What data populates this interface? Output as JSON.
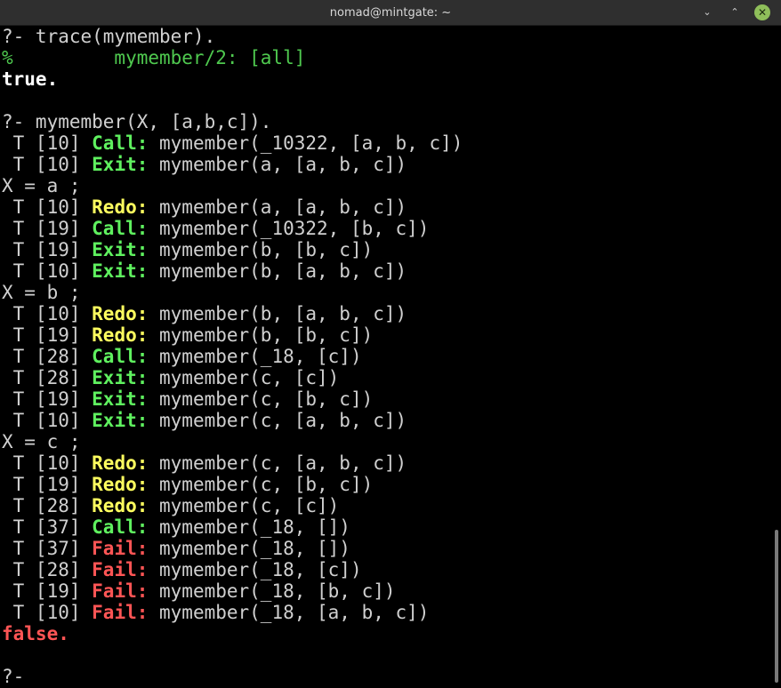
{
  "window": {
    "title": "nomad@mintgate: ~",
    "minimize_label": "⌄",
    "maximize_label": "⌃",
    "close_label": "✕"
  },
  "terminal": {
    "lines": [
      [
        {
          "text": "?- trace(mymember).",
          "style": "plain"
        }
      ],
      [
        {
          "text": "%         mymember/2: [all]",
          "style": "green"
        }
      ],
      [
        {
          "text": "true.",
          "style": "bold-white"
        }
      ],
      [
        {
          "text": "",
          "style": "plain"
        }
      ],
      [
        {
          "text": "?- mymember(X, [a,b,c]).",
          "style": "plain"
        }
      ],
      [
        {
          "text": " T [10] ",
          "style": "plain"
        },
        {
          "text": "Call:",
          "style": "call"
        },
        {
          "text": " mymember(_10322, [a, b, c])",
          "style": "plain"
        }
      ],
      [
        {
          "text": " T [10] ",
          "style": "plain"
        },
        {
          "text": "Exit:",
          "style": "exit"
        },
        {
          "text": " mymember(a, [a, b, c])",
          "style": "plain"
        }
      ],
      [
        {
          "text": "X = a ;",
          "style": "plain"
        }
      ],
      [
        {
          "text": " T [10] ",
          "style": "plain"
        },
        {
          "text": "Redo:",
          "style": "redo"
        },
        {
          "text": " mymember(a, [a, b, c])",
          "style": "plain"
        }
      ],
      [
        {
          "text": " T [19] ",
          "style": "plain"
        },
        {
          "text": "Call:",
          "style": "call"
        },
        {
          "text": " mymember(_10322, [b, c])",
          "style": "plain"
        }
      ],
      [
        {
          "text": " T [19] ",
          "style": "plain"
        },
        {
          "text": "Exit:",
          "style": "exit"
        },
        {
          "text": " mymember(b, [b, c])",
          "style": "plain"
        }
      ],
      [
        {
          "text": " T [10] ",
          "style": "plain"
        },
        {
          "text": "Exit:",
          "style": "exit"
        },
        {
          "text": " mymember(b, [a, b, c])",
          "style": "plain"
        }
      ],
      [
        {
          "text": "X = b ;",
          "style": "plain"
        }
      ],
      [
        {
          "text": " T [10] ",
          "style": "plain"
        },
        {
          "text": "Redo:",
          "style": "redo"
        },
        {
          "text": " mymember(b, [a, b, c])",
          "style": "plain"
        }
      ],
      [
        {
          "text": " T [19] ",
          "style": "plain"
        },
        {
          "text": "Redo:",
          "style": "redo"
        },
        {
          "text": " mymember(b, [b, c])",
          "style": "plain"
        }
      ],
      [
        {
          "text": " T [28] ",
          "style": "plain"
        },
        {
          "text": "Call:",
          "style": "call"
        },
        {
          "text": " mymember(_18, [c])",
          "style": "plain"
        }
      ],
      [
        {
          "text": " T [28] ",
          "style": "plain"
        },
        {
          "text": "Exit:",
          "style": "exit"
        },
        {
          "text": " mymember(c, [c])",
          "style": "plain"
        }
      ],
      [
        {
          "text": " T [19] ",
          "style": "plain"
        },
        {
          "text": "Exit:",
          "style": "exit"
        },
        {
          "text": " mymember(c, [b, c])",
          "style": "plain"
        }
      ],
      [
        {
          "text": " T [10] ",
          "style": "plain"
        },
        {
          "text": "Exit:",
          "style": "exit"
        },
        {
          "text": " mymember(c, [a, b, c])",
          "style": "plain"
        }
      ],
      [
        {
          "text": "X = c ;",
          "style": "plain"
        }
      ],
      [
        {
          "text": " T [10] ",
          "style": "plain"
        },
        {
          "text": "Redo:",
          "style": "redo"
        },
        {
          "text": " mymember(c, [a, b, c])",
          "style": "plain"
        }
      ],
      [
        {
          "text": " T [19] ",
          "style": "plain"
        },
        {
          "text": "Redo:",
          "style": "redo"
        },
        {
          "text": " mymember(c, [b, c])",
          "style": "plain"
        }
      ],
      [
        {
          "text": " T [28] ",
          "style": "plain"
        },
        {
          "text": "Redo:",
          "style": "redo"
        },
        {
          "text": " mymember(c, [c])",
          "style": "plain"
        }
      ],
      [
        {
          "text": " T [37] ",
          "style": "plain"
        },
        {
          "text": "Call:",
          "style": "call"
        },
        {
          "text": " mymember(_18, [])",
          "style": "plain"
        }
      ],
      [
        {
          "text": " T [37] ",
          "style": "plain"
        },
        {
          "text": "Fail:",
          "style": "fail"
        },
        {
          "text": " mymember(_18, [])",
          "style": "plain"
        }
      ],
      [
        {
          "text": " T [28] ",
          "style": "plain"
        },
        {
          "text": "Fail:",
          "style": "fail"
        },
        {
          "text": " mymember(_18, [c])",
          "style": "plain"
        }
      ],
      [
        {
          "text": " T [19] ",
          "style": "plain"
        },
        {
          "text": "Fail:",
          "style": "fail"
        },
        {
          "text": " mymember(_18, [b, c])",
          "style": "plain"
        }
      ],
      [
        {
          "text": " T [10] ",
          "style": "plain"
        },
        {
          "text": "Fail:",
          "style": "fail"
        },
        {
          "text": " mymember(_18, [a, b, c])",
          "style": "plain"
        }
      ],
      [
        {
          "text": "false.",
          "style": "false"
        }
      ],
      [
        {
          "text": "",
          "style": "plain"
        }
      ],
      [
        {
          "text": "?-",
          "style": "plain"
        }
      ]
    ]
  },
  "colors": {
    "background": "#000000",
    "text": "#d0d0d0",
    "green": "#4fc94f",
    "call_exit": "#5ff15f",
    "redo": "#ffff5f",
    "fail": "#ff5555"
  }
}
